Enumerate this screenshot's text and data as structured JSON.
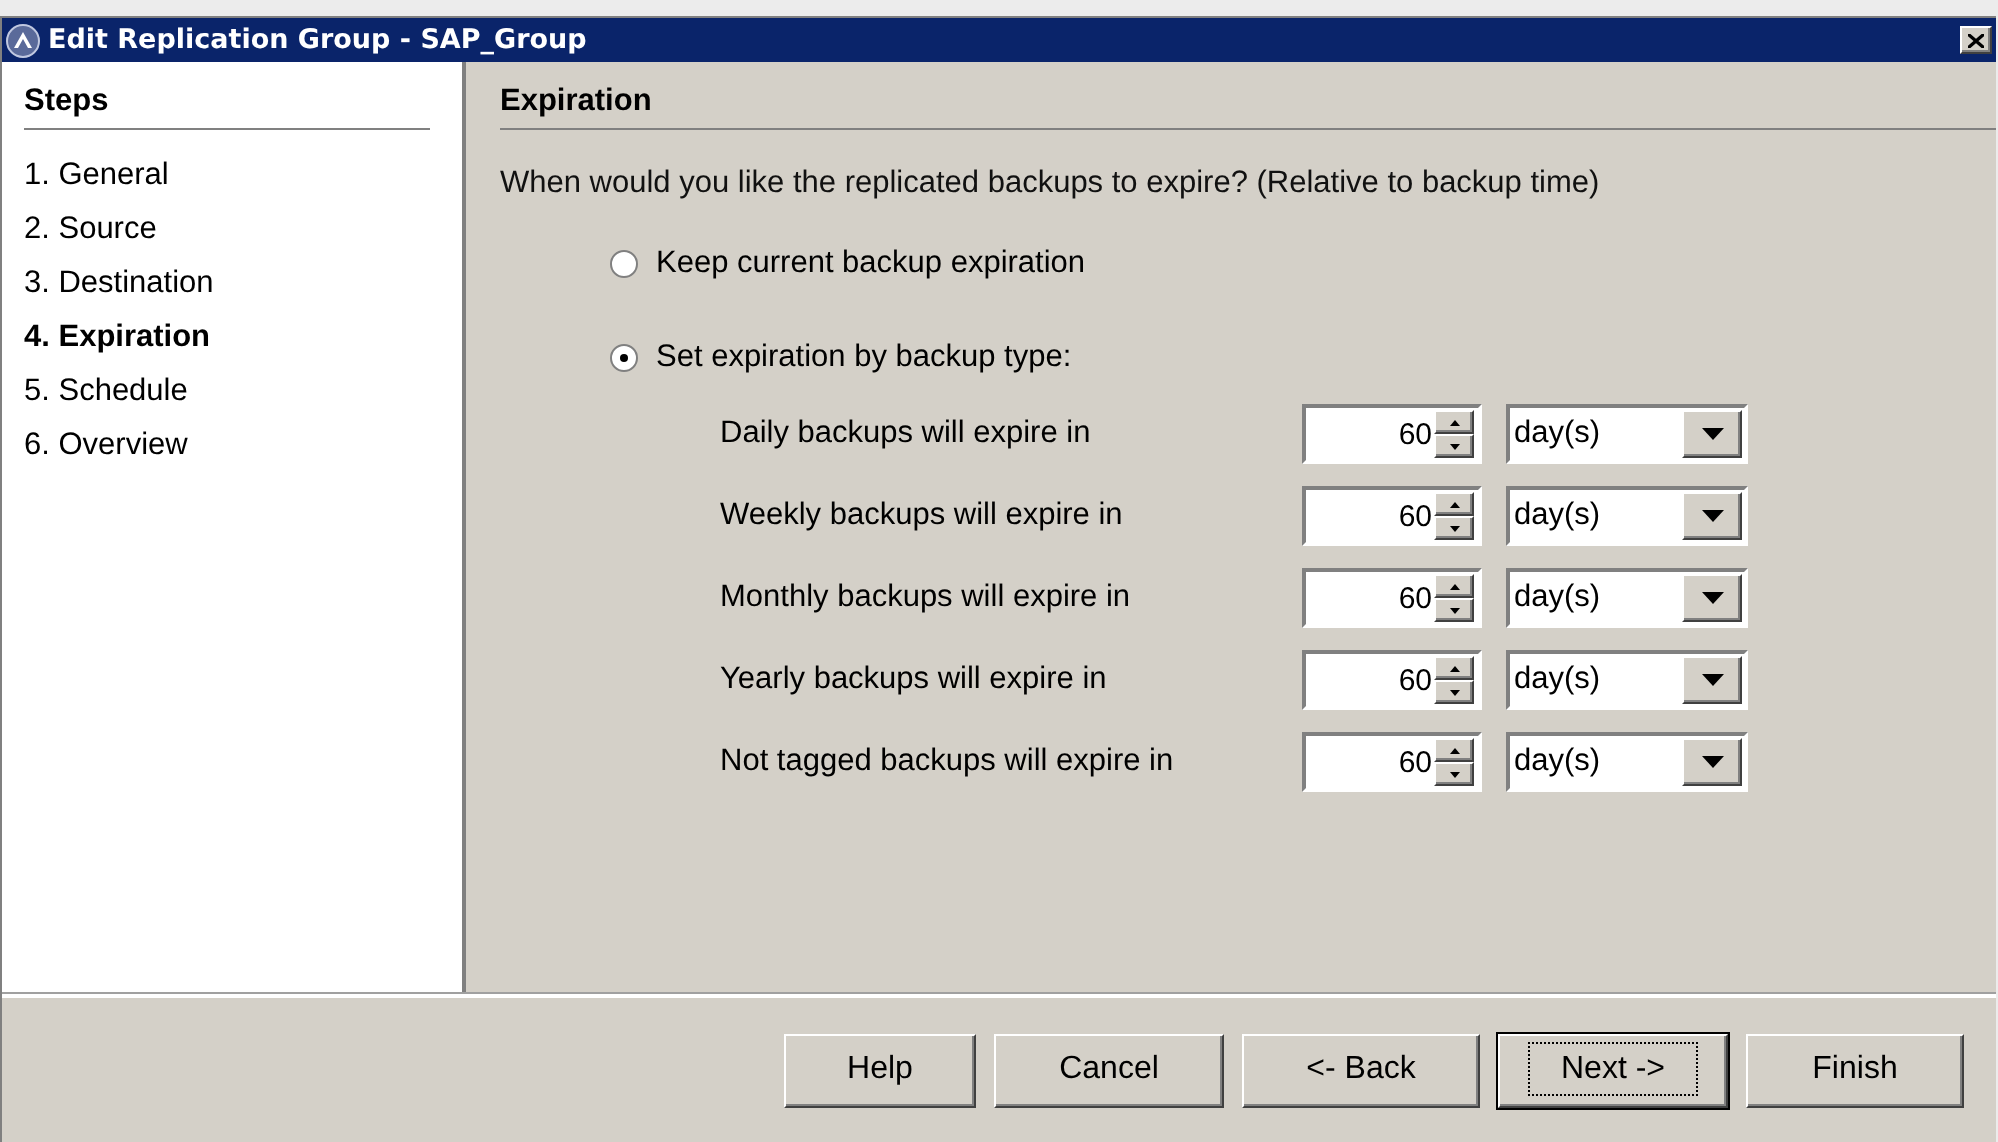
{
  "window": {
    "title": "Edit Replication Group - SAP_Group"
  },
  "steps": {
    "heading": "Steps",
    "items": [
      {
        "label": "1. General",
        "selected": false
      },
      {
        "label": "2. Source",
        "selected": false
      },
      {
        "label": "3. Destination",
        "selected": false
      },
      {
        "label": "4. Expiration",
        "selected": true
      },
      {
        "label": "5. Schedule",
        "selected": false
      },
      {
        "label": "6. Overview",
        "selected": false
      }
    ]
  },
  "content": {
    "heading": "Expiration",
    "question": "When would you like the replicated backups to expire? (Relative to backup time)",
    "options": [
      {
        "label": "Keep current backup expiration",
        "selected": false
      },
      {
        "label": "Set expiration by backup type:",
        "selected": true
      }
    ],
    "rows": [
      {
        "label": "Daily backups will expire in",
        "value": "60",
        "unit": "day(s)"
      },
      {
        "label": "Weekly backups will expire in",
        "value": "60",
        "unit": "day(s)"
      },
      {
        "label": "Monthly backups will expire in",
        "value": "60",
        "unit": "day(s)"
      },
      {
        "label": "Yearly backups will expire in",
        "value": "60",
        "unit": "day(s)"
      },
      {
        "label": "Not tagged backups will expire in",
        "value": "60",
        "unit": "day(s)"
      }
    ]
  },
  "buttons": [
    {
      "label": "Help",
      "default": false
    },
    {
      "label": "Cancel",
      "default": false
    },
    {
      "label": "<- Back",
      "default": false
    },
    {
      "label": "Next ->",
      "default": true
    },
    {
      "label": "Finish",
      "default": false
    }
  ]
}
